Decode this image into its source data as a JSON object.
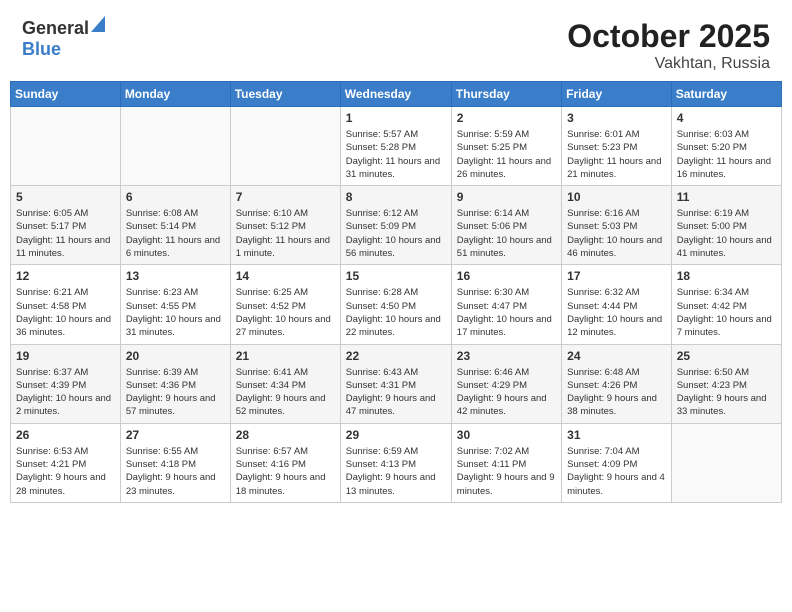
{
  "header": {
    "logo_general": "General",
    "logo_blue": "Blue",
    "month": "October 2025",
    "location": "Vakhtan, Russia"
  },
  "weekdays": [
    "Sunday",
    "Monday",
    "Tuesday",
    "Wednesday",
    "Thursday",
    "Friday",
    "Saturday"
  ],
  "weeks": [
    [
      {
        "day": "",
        "info": ""
      },
      {
        "day": "",
        "info": ""
      },
      {
        "day": "",
        "info": ""
      },
      {
        "day": "1",
        "info": "Sunrise: 5:57 AM\nSunset: 5:28 PM\nDaylight: 11 hours and 31 minutes."
      },
      {
        "day": "2",
        "info": "Sunrise: 5:59 AM\nSunset: 5:25 PM\nDaylight: 11 hours and 26 minutes."
      },
      {
        "day": "3",
        "info": "Sunrise: 6:01 AM\nSunset: 5:23 PM\nDaylight: 11 hours and 21 minutes."
      },
      {
        "day": "4",
        "info": "Sunrise: 6:03 AM\nSunset: 5:20 PM\nDaylight: 11 hours and 16 minutes."
      }
    ],
    [
      {
        "day": "5",
        "info": "Sunrise: 6:05 AM\nSunset: 5:17 PM\nDaylight: 11 hours and 11 minutes."
      },
      {
        "day": "6",
        "info": "Sunrise: 6:08 AM\nSunset: 5:14 PM\nDaylight: 11 hours and 6 minutes."
      },
      {
        "day": "7",
        "info": "Sunrise: 6:10 AM\nSunset: 5:12 PM\nDaylight: 11 hours and 1 minute."
      },
      {
        "day": "8",
        "info": "Sunrise: 6:12 AM\nSunset: 5:09 PM\nDaylight: 10 hours and 56 minutes."
      },
      {
        "day": "9",
        "info": "Sunrise: 6:14 AM\nSunset: 5:06 PM\nDaylight: 10 hours and 51 minutes."
      },
      {
        "day": "10",
        "info": "Sunrise: 6:16 AM\nSunset: 5:03 PM\nDaylight: 10 hours and 46 minutes."
      },
      {
        "day": "11",
        "info": "Sunrise: 6:19 AM\nSunset: 5:00 PM\nDaylight: 10 hours and 41 minutes."
      }
    ],
    [
      {
        "day": "12",
        "info": "Sunrise: 6:21 AM\nSunset: 4:58 PM\nDaylight: 10 hours and 36 minutes."
      },
      {
        "day": "13",
        "info": "Sunrise: 6:23 AM\nSunset: 4:55 PM\nDaylight: 10 hours and 31 minutes."
      },
      {
        "day": "14",
        "info": "Sunrise: 6:25 AM\nSunset: 4:52 PM\nDaylight: 10 hours and 27 minutes."
      },
      {
        "day": "15",
        "info": "Sunrise: 6:28 AM\nSunset: 4:50 PM\nDaylight: 10 hours and 22 minutes."
      },
      {
        "day": "16",
        "info": "Sunrise: 6:30 AM\nSunset: 4:47 PM\nDaylight: 10 hours and 17 minutes."
      },
      {
        "day": "17",
        "info": "Sunrise: 6:32 AM\nSunset: 4:44 PM\nDaylight: 10 hours and 12 minutes."
      },
      {
        "day": "18",
        "info": "Sunrise: 6:34 AM\nSunset: 4:42 PM\nDaylight: 10 hours and 7 minutes."
      }
    ],
    [
      {
        "day": "19",
        "info": "Sunrise: 6:37 AM\nSunset: 4:39 PM\nDaylight: 10 hours and 2 minutes."
      },
      {
        "day": "20",
        "info": "Sunrise: 6:39 AM\nSunset: 4:36 PM\nDaylight: 9 hours and 57 minutes."
      },
      {
        "day": "21",
        "info": "Sunrise: 6:41 AM\nSunset: 4:34 PM\nDaylight: 9 hours and 52 minutes."
      },
      {
        "day": "22",
        "info": "Sunrise: 6:43 AM\nSunset: 4:31 PM\nDaylight: 9 hours and 47 minutes."
      },
      {
        "day": "23",
        "info": "Sunrise: 6:46 AM\nSunset: 4:29 PM\nDaylight: 9 hours and 42 minutes."
      },
      {
        "day": "24",
        "info": "Sunrise: 6:48 AM\nSunset: 4:26 PM\nDaylight: 9 hours and 38 minutes."
      },
      {
        "day": "25",
        "info": "Sunrise: 6:50 AM\nSunset: 4:23 PM\nDaylight: 9 hours and 33 minutes."
      }
    ],
    [
      {
        "day": "26",
        "info": "Sunrise: 6:53 AM\nSunset: 4:21 PM\nDaylight: 9 hours and 28 minutes."
      },
      {
        "day": "27",
        "info": "Sunrise: 6:55 AM\nSunset: 4:18 PM\nDaylight: 9 hours and 23 minutes."
      },
      {
        "day": "28",
        "info": "Sunrise: 6:57 AM\nSunset: 4:16 PM\nDaylight: 9 hours and 18 minutes."
      },
      {
        "day": "29",
        "info": "Sunrise: 6:59 AM\nSunset: 4:13 PM\nDaylight: 9 hours and 13 minutes."
      },
      {
        "day": "30",
        "info": "Sunrise: 7:02 AM\nSunset: 4:11 PM\nDaylight: 9 hours and 9 minutes."
      },
      {
        "day": "31",
        "info": "Sunrise: 7:04 AM\nSunset: 4:09 PM\nDaylight: 9 hours and 4 minutes."
      },
      {
        "day": "",
        "info": ""
      }
    ]
  ]
}
